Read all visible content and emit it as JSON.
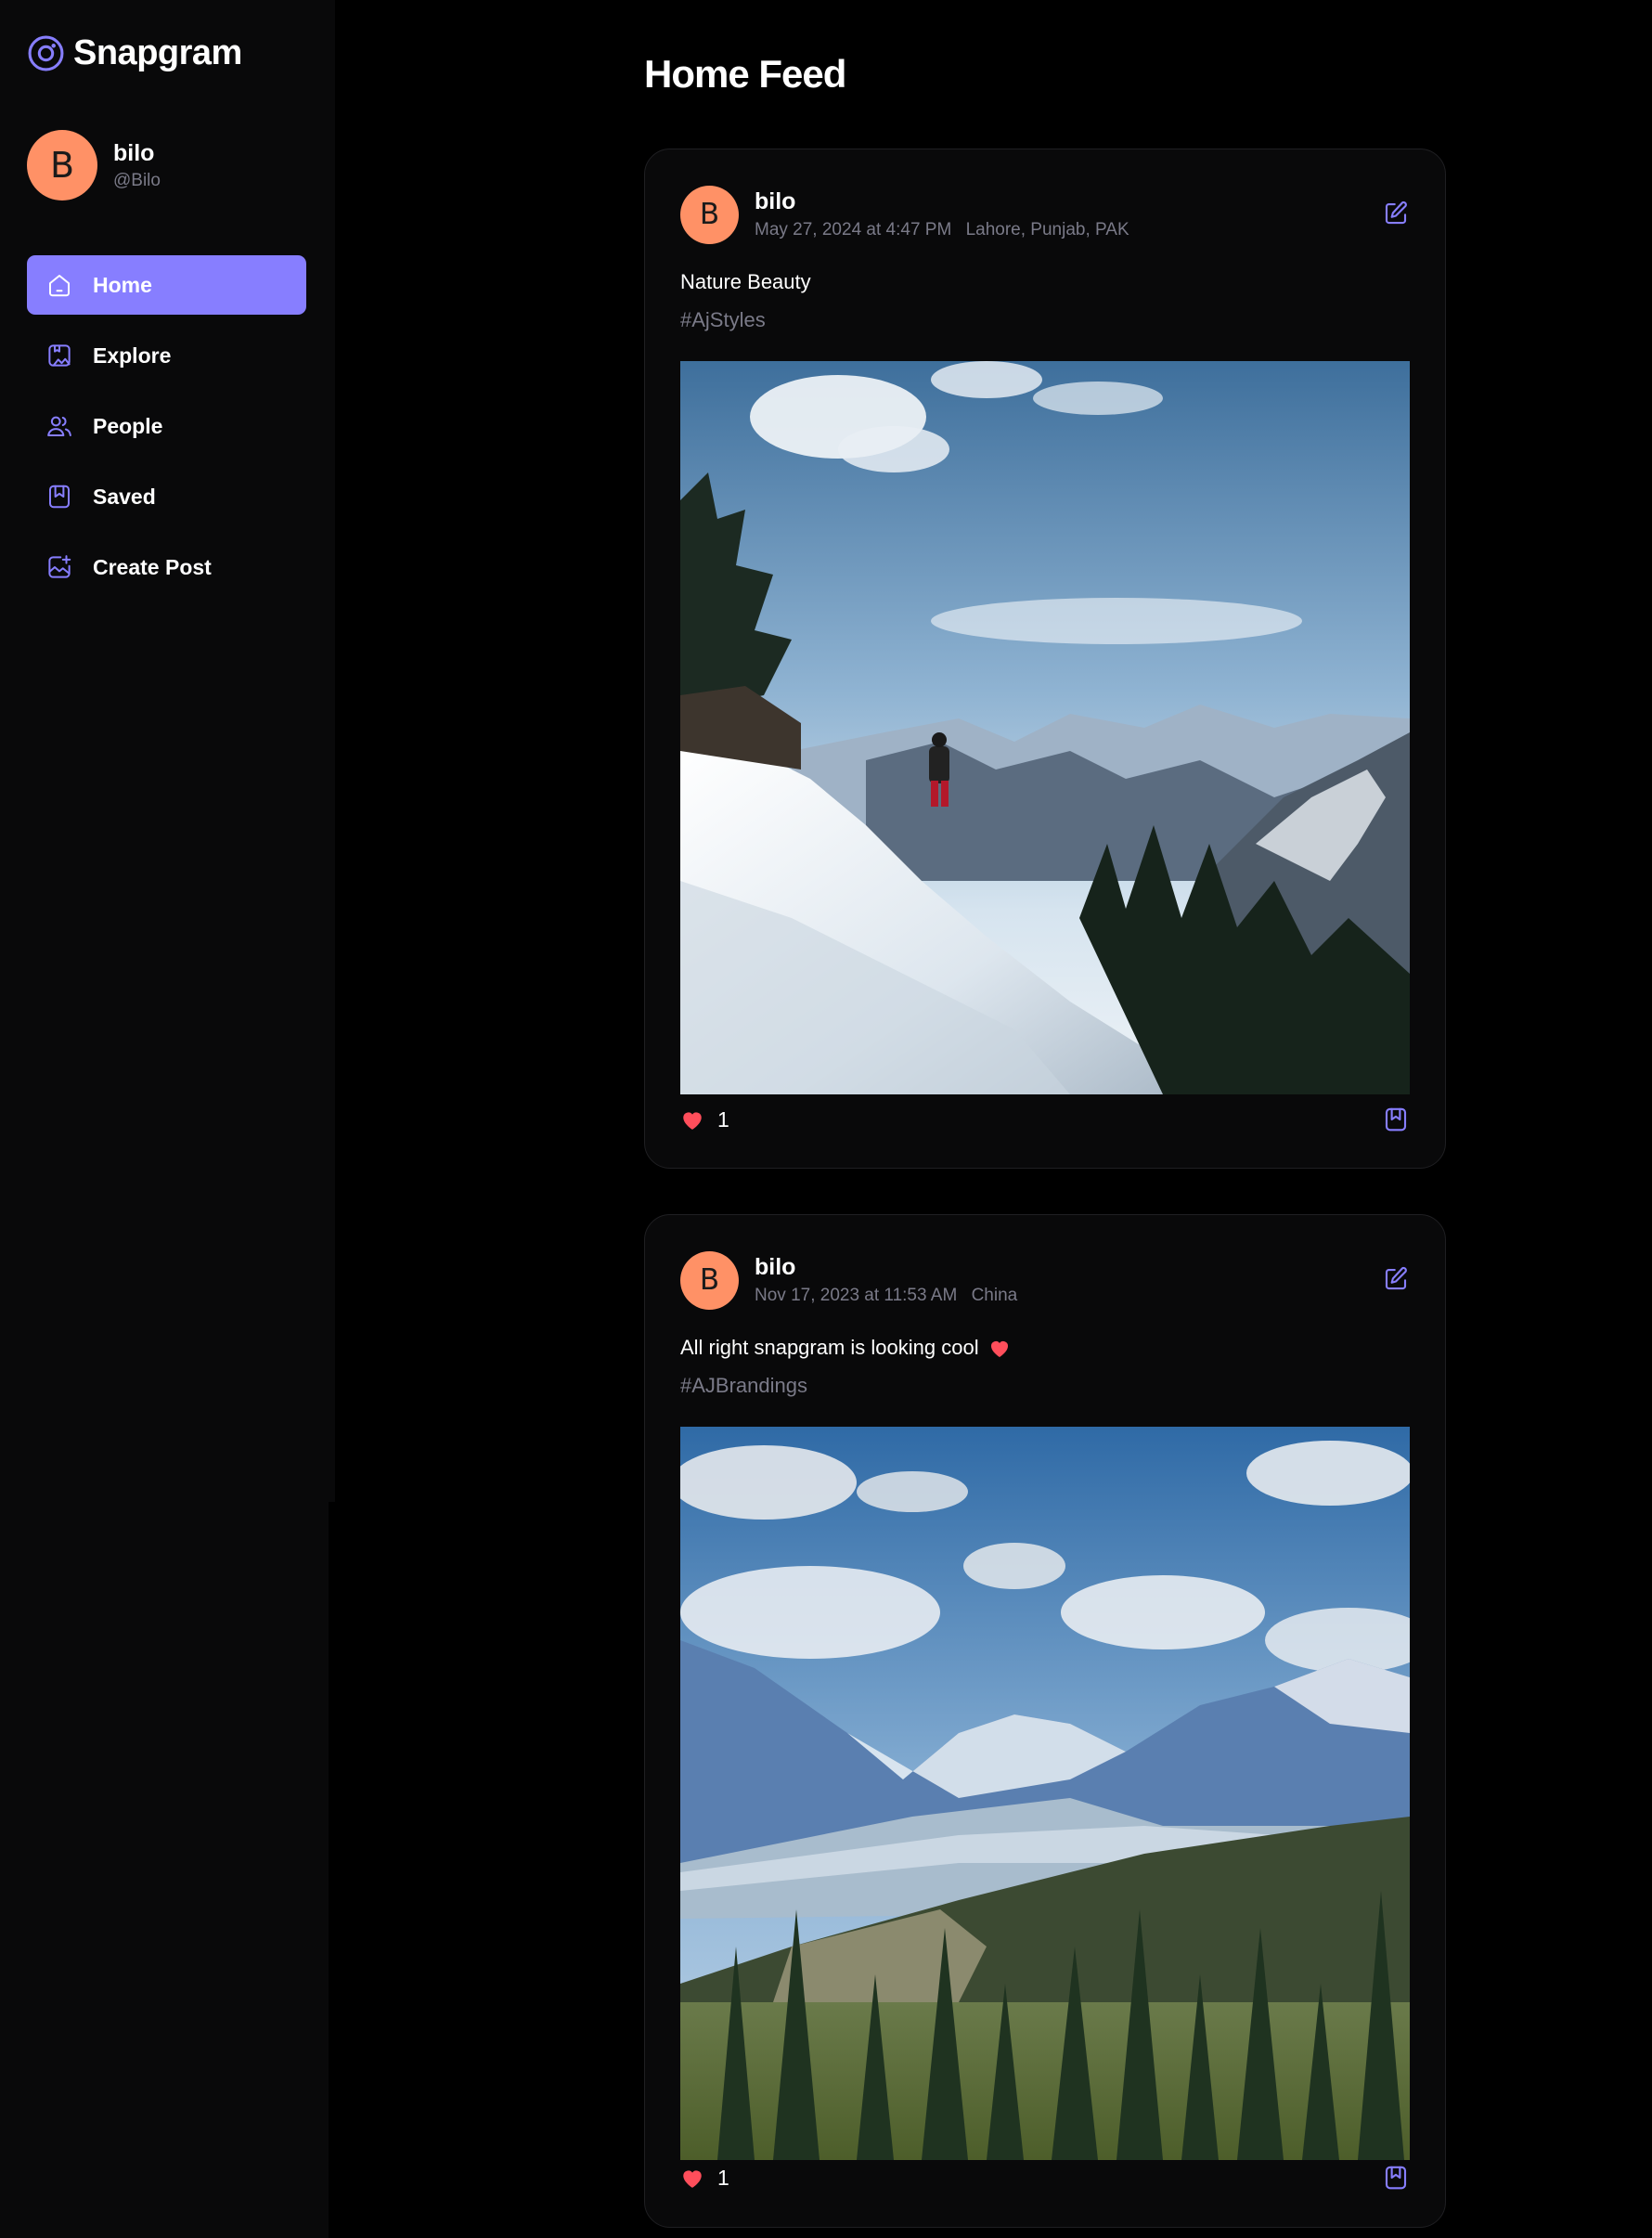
{
  "app": {
    "name": "Snapgram"
  },
  "user": {
    "name": "bilo",
    "handle": "@Bilo",
    "avatar_initial": "B"
  },
  "nav": {
    "items": [
      {
        "label": "Home",
        "icon": "home-icon",
        "active": true
      },
      {
        "label": "Explore",
        "icon": "explore-icon",
        "active": false
      },
      {
        "label": "People",
        "icon": "people-icon",
        "active": false
      },
      {
        "label": "Saved",
        "icon": "bookmark-icon",
        "active": false
      },
      {
        "label": "Create Post",
        "icon": "add-image-icon",
        "active": false
      }
    ]
  },
  "feed": {
    "title": "Home Feed",
    "posts": [
      {
        "author": "bilo",
        "avatar_initial": "B",
        "date": "May 27, 2024 at 4:47 PM",
        "location": "Lahore, Punjab, PAK",
        "caption": "Nature Beauty",
        "tag": "#AjStyles",
        "likes": "1",
        "image": "snowy-mountain-hiker"
      },
      {
        "author": "bilo",
        "avatar_initial": "B",
        "date": "Nov 17, 2023 at 11:53 AM",
        "location": "China",
        "caption": "All right snapgram is looking cool",
        "tag": "#AJBrandings",
        "likes": "1",
        "image": "mountain-valley-forest"
      }
    ]
  },
  "colors": {
    "accent": "#877eff",
    "avatar": "#ff9166",
    "muted": "#7a7a88",
    "like": "#ff4e5b",
    "background": "#000000",
    "panel": "#09090a"
  }
}
